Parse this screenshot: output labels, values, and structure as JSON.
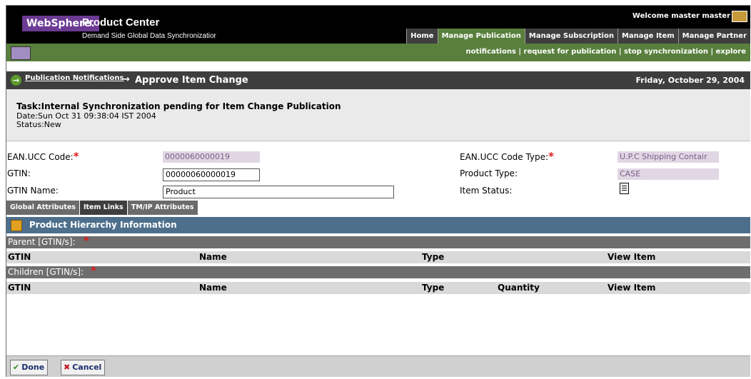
{
  "header": {
    "logo_brand": "WebSphere.",
    "product_name": "Product Center",
    "product_subtitle": "Demand Side Global Data Synchronizatior",
    "welcome_text": "Welcome master master",
    "nav_tabs": [
      {
        "label": "Home",
        "active": false
      },
      {
        "label": "Manage Publication",
        "active": true
      },
      {
        "label": "Manage Subscription",
        "active": false
      },
      {
        "label": "Manage Item",
        "active": false
      },
      {
        "label": "Manage Partner",
        "active": false
      }
    ],
    "sub_links": [
      "notifications",
      "request for publication",
      "stop synchronization",
      "explore"
    ]
  },
  "titlebar": {
    "breadcrumb_link": "Publication Notifications",
    "arrow": "→",
    "page_title": "Approve Item Change",
    "date": "Friday, October 29, 2004"
  },
  "task": {
    "title": "Task:Internal Synchronization pending for Item Change Publication",
    "date": "Date:Sun Oct 31 09:38:04 IST 2004",
    "status": "Status:New"
  },
  "form": {
    "ean_label": "EAN.UCC Code:",
    "ean_value": "0000060000019",
    "gtin_label": "GTIN:",
    "gtin_value": "00000060000019",
    "gtin_name_label": "GTIN Name:",
    "gtin_name_value": "Product",
    "ean_type_label": "EAN.UCC Code Type:",
    "ean_type_value": "U.P.C Shipping Contair",
    "product_type_label": "Product Type:",
    "product_type_value": "CASE",
    "item_status_label": "Item Status:",
    "required_mark": "*"
  },
  "tabs": [
    {
      "label": "Global Attributes",
      "active": false
    },
    {
      "label": "Item Links",
      "active": true
    },
    {
      "label": "TM/IP Attributes",
      "active": false
    }
  ],
  "hierarchy": {
    "title": "Product Hierarchy Information",
    "parent_label": "Parent [GTIN/s]:",
    "parent_columns": [
      "GTIN",
      "Name",
      "Type",
      "View Item"
    ],
    "children_label": "Children [GTIN/s]:",
    "children_columns": [
      "GTIN",
      "Name",
      "Type",
      "Quantity",
      "View Item"
    ]
  },
  "footer": {
    "done_label": "Done",
    "cancel_label": "Cancel"
  },
  "colors": {
    "nav_active": "#587f3c",
    "titlebar": "#3e3e3e",
    "hierarchy_bar": "#4d6f8c",
    "required": "#e01b1b",
    "readonly_field": "#e1d6e4"
  }
}
